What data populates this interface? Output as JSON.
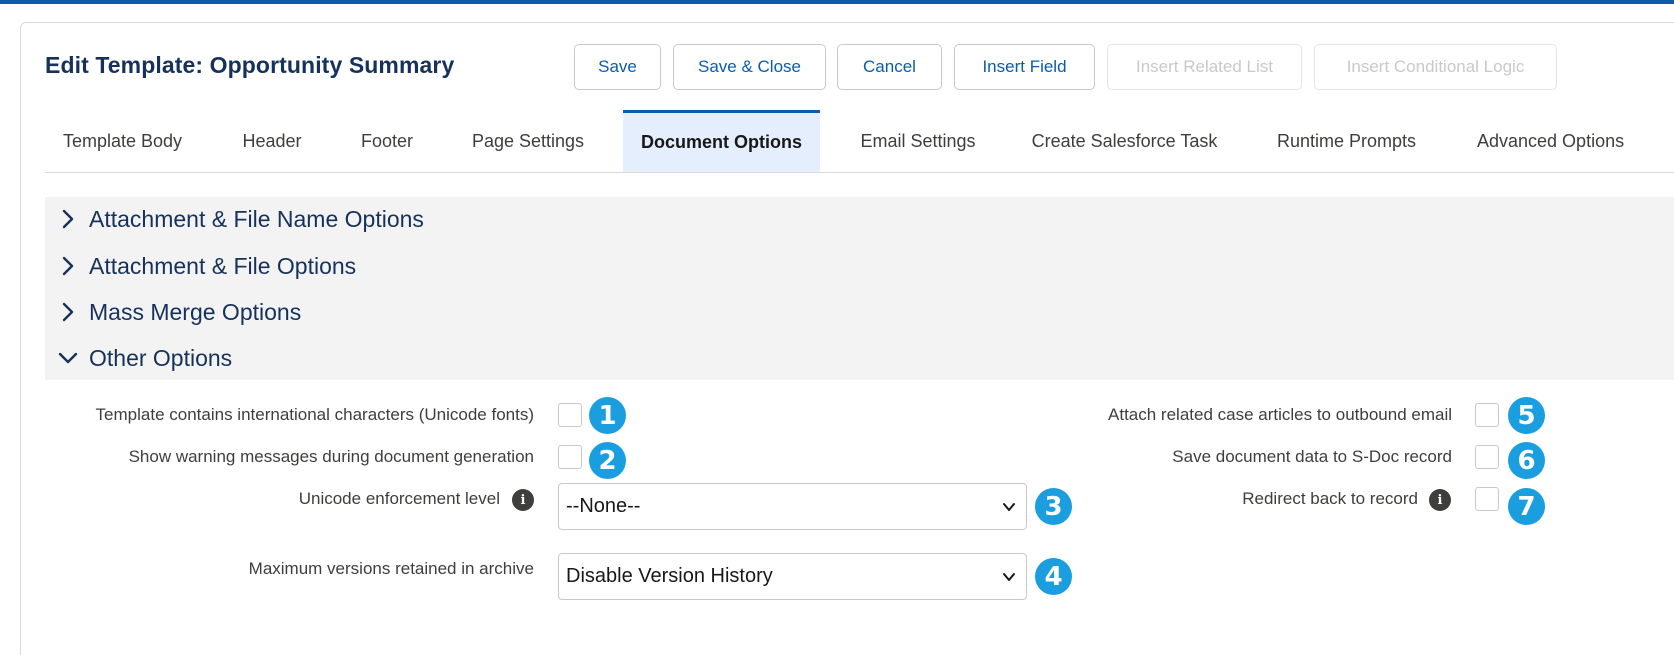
{
  "title": "Edit Template: Opportunity Summary",
  "toolbar": {
    "save": "Save",
    "save_close": "Save & Close",
    "cancel": "Cancel",
    "insert_field": "Insert Field",
    "insert_related_list": "Insert Related List",
    "insert_conditional_logic": "Insert Conditional Logic"
  },
  "tabs": [
    {
      "label": "Template Body"
    },
    {
      "label": "Header"
    },
    {
      "label": "Footer"
    },
    {
      "label": "Page Settings"
    },
    {
      "label": "Document Options",
      "active": true
    },
    {
      "label": "Email Settings"
    },
    {
      "label": "Create Salesforce Task"
    },
    {
      "label": "Runtime Prompts"
    },
    {
      "label": "Advanced Options"
    }
  ],
  "sections": [
    {
      "label": "Attachment & File Name Options",
      "expanded": false
    },
    {
      "label": "Attachment & File Options",
      "expanded": false
    },
    {
      "label": "Mass Merge Options",
      "expanded": false
    },
    {
      "label": "Other Options",
      "expanded": true
    }
  ],
  "other_options": {
    "left": {
      "unicode_fonts_label": "Template contains international characters (Unicode fonts)",
      "show_warnings_label": "Show warning messages during document generation",
      "unicode_enforcement_label": "Unicode enforcement level",
      "unicode_enforcement_value": "--None--",
      "max_versions_label": "Maximum versions retained in archive",
      "max_versions_value": "Disable Version History"
    },
    "right": {
      "attach_case_articles_label": "Attach related case articles to outbound email",
      "save_doc_data_label": "Save document data to S-Doc record",
      "redirect_label": "Redirect back to record"
    },
    "badges": [
      "1",
      "2",
      "3",
      "4",
      "5",
      "6",
      "7"
    ]
  },
  "colors": {
    "brand_blue": "#0b5cab",
    "badge_blue": "#1b9ee0",
    "active_tab_bg": "#e5eefc",
    "section_bg": "#f3f3f3",
    "heading_navy": "#16325c"
  }
}
